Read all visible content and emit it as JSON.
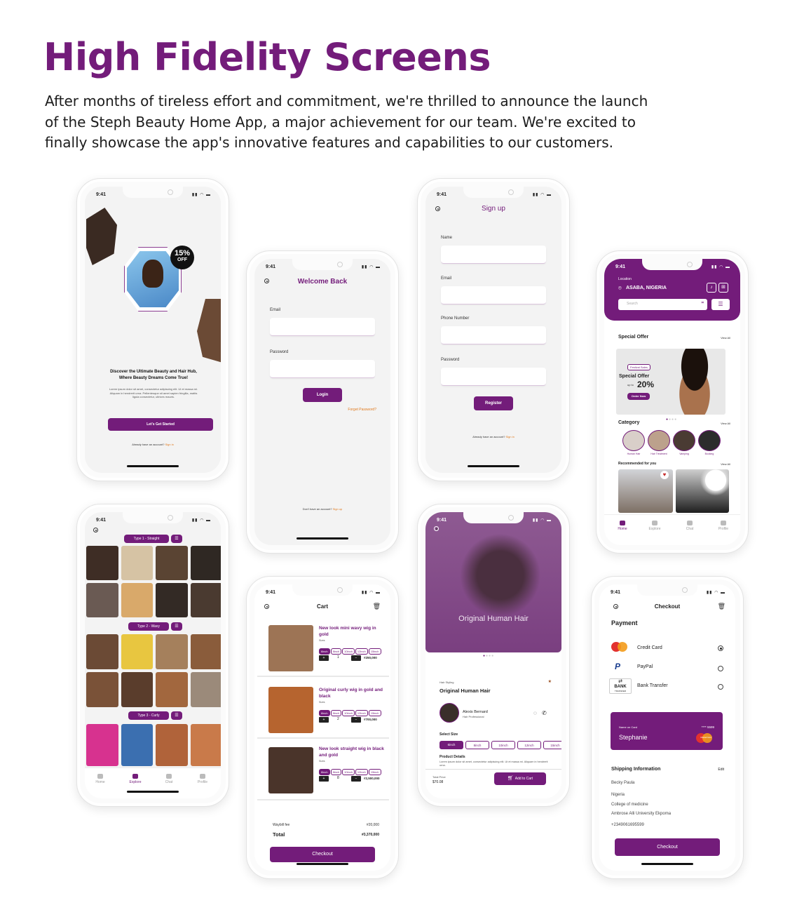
{
  "headline": "High Fidelity Screens",
  "intro": "After months of tireless effort and commitment, we're thrilled to announce the launch of the Steph Beauty Home App, a major achievement for our team. We're excited to finally showcase the app's innovative features and capabilities to our customers.",
  "brand_color": "#731C7A",
  "status_time": "9:41",
  "onboarding": {
    "badge_percent": "15%",
    "badge_off": "OFF",
    "title": "Discover the Ultimate Beauty and Hair Hub, Where Beauty Dreams Come True!",
    "body": "Lorem ipsum dolor sit amet, consectetur adipiscing elit. Ut et massa mi. Aliquam in hendrerit urna. Pellentesque sit amet sapien fringilla, mattis ligula consectetur, ultrices mauris.",
    "cta": "Let's Get Started",
    "footer_text": "Already have an account?",
    "footer_link": "Sign in"
  },
  "login": {
    "title": "Welcome Back",
    "email_label": "Email",
    "password_label": "Password",
    "login_button": "Login",
    "forgot": "Forget Password?",
    "footer_text": "Don't have an account?",
    "footer_link": "Sign up"
  },
  "signup": {
    "title": "Sign up",
    "name_label": "Name",
    "email_label": "Email",
    "phone_label": "Phone Number",
    "password_label": "Password",
    "register_button": "Register",
    "footer_text": "Already have an account?",
    "footer_link": "Sign in"
  },
  "home": {
    "location_label": "Location",
    "location": "ASABA, NIGERIA",
    "search_placeholder": "Search",
    "special_offer_title": "Special Offer",
    "view_all": "View All",
    "festival_tag": "Festival Sales",
    "offer_heading": "Special Offer",
    "offer_upto": "up to",
    "offer_percent": "20%",
    "order_now": "Order Now",
    "category_title": "Category",
    "categories": [
      "Human Hair",
      "Hair Treatment",
      "Vamping",
      "Booking"
    ],
    "recommended_title": "Recommended for you",
    "nav": [
      "Home",
      "Explore",
      "Chat",
      "Profile"
    ]
  },
  "explore": {
    "type1": "Type 1 - Straight",
    "type2": "Type 2 - Wavy",
    "type3": "Type 3 - Curly",
    "nav": [
      "Home",
      "Explore",
      "Chat",
      "Profile"
    ]
  },
  "cart": {
    "title": "Cart",
    "items": [
      {
        "name": "New look mini  wavy wig in gold",
        "sizes_label": "Sizes",
        "sizes": [
          "6inch",
          "8inch",
          "10inch",
          "12inch",
          "15inch"
        ],
        "qty": "1",
        "price": "#250,000"
      },
      {
        "name": "Original curly wig in gold and black",
        "sizes_label": "Sizes",
        "sizes": [
          "6inch",
          "8inch",
          "10inch",
          "12inch",
          "15inch"
        ],
        "qty": "2",
        "price": "#700,000"
      },
      {
        "name": "New look  straight wig in black and gold",
        "sizes_label": "Sizes",
        "sizes": [
          "6inch",
          "8inch",
          "10inch",
          "12inch",
          "15inch"
        ],
        "qty": "8",
        "price": "#2,500,000"
      }
    ],
    "waybill_label": "Waybill fee",
    "waybill_value": "#20,000",
    "total_label": "Total",
    "total_value": "#3,370,000",
    "checkout": "Checkout"
  },
  "product": {
    "hero_title": "Original Human Hair",
    "category": "Hair Styling",
    "name": "Original Human Hair",
    "stylist_name": "Alexis Bernard",
    "stylist_role": "Hair Professional",
    "select_size": "Select Size",
    "sizes": [
      "6inch",
      "8inch",
      "10inch",
      "12inch",
      "15inch"
    ],
    "details_label": "Product Details",
    "details_text": "Lorem ipsum dolor sit amet, consectetur adipiscing elit. Ut et massa mi. Aliquam in hendrerit urna.",
    "total_price_label": "Total Price",
    "total_price": "$70.08",
    "add_to_cart": "Add to Cart"
  },
  "checkout": {
    "title": "Checkout",
    "payment_title": "Payment",
    "methods": [
      {
        "label": "Credit Card",
        "selected": true,
        "icon": "mastercard-icon"
      },
      {
        "label": "PayPal",
        "selected": false,
        "icon": "paypal-icon"
      },
      {
        "label": "Bank Transfer",
        "selected": false,
        "icon": "bank-transfer-icon"
      }
    ],
    "card_label": "Name on Card",
    "card_number": "**** 5599",
    "card_name": "Stephanie",
    "card_brand": "MasterCard",
    "bank_logo_text": "BANK",
    "bank_logo_sub": "TRANSFER",
    "shipping_title": "Shipping Information",
    "edit": "Edit",
    "shipping_name": "Becky Paula",
    "shipping_lines": [
      "Nigeria",
      "College of medicine",
      "Ambrose Alli University Ekpoma"
    ],
    "phone": "+2349061695599",
    "checkout_button": "Checkout"
  }
}
